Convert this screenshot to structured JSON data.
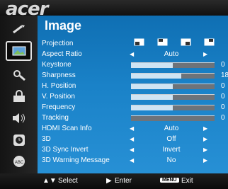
{
  "brand": "acer",
  "panel_title": "Image",
  "sidebar": [
    {
      "icon": "wand-icon"
    },
    {
      "icon": "image-icon",
      "active": true
    },
    {
      "icon": "tools-icon"
    },
    {
      "icon": "lock-icon"
    },
    {
      "icon": "speaker-icon"
    },
    {
      "icon": "clock-icon"
    },
    {
      "icon": "abc-language-icon"
    }
  ],
  "rows": [
    {
      "label": "Projection",
      "type": "icons"
    },
    {
      "label": "Aspect Ratio",
      "type": "select",
      "value": "Auto"
    },
    {
      "label": "Keystone",
      "type": "slider",
      "level": 0.5,
      "num": "0"
    },
    {
      "label": "Sharpness",
      "type": "slider",
      "level": 0.6,
      "num": "18"
    },
    {
      "label": "H. Position",
      "type": "slider",
      "level": 0.5,
      "num": "0"
    },
    {
      "label": "V. Position",
      "type": "slider",
      "level": 0.5,
      "num": "0"
    },
    {
      "label": "Frequency",
      "type": "slider",
      "level": 0.5,
      "num": "0"
    },
    {
      "label": "Tracking",
      "type": "slider",
      "level": 0.0,
      "num": "0"
    },
    {
      "label": "HDMI Scan Info",
      "type": "select",
      "value": "Auto"
    },
    {
      "label": "3D",
      "type": "select",
      "value": "Off"
    },
    {
      "label": "3D Sync Invert",
      "type": "select",
      "value": "Invert"
    },
    {
      "label": "3D Warning Message",
      "type": "select",
      "value": "No"
    }
  ],
  "footer": {
    "select_label": "Select",
    "enter_label": "Enter",
    "menu_key": "MENU",
    "exit_label": "Exit"
  }
}
